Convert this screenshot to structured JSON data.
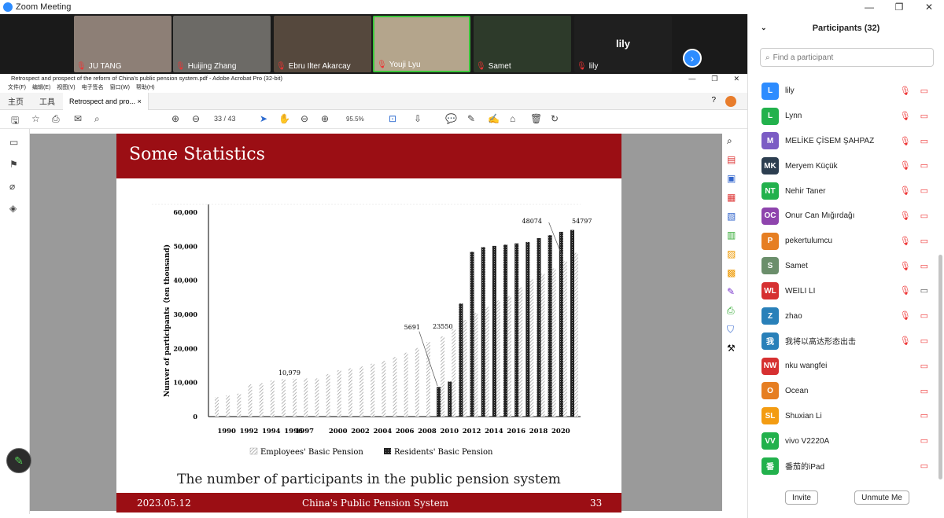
{
  "window": {
    "title": "Zoom Meeting"
  },
  "video_tiles": [
    {
      "name": "JU TANG",
      "bg": "#8d7f76"
    },
    {
      "name": "Huijing Zhang",
      "bg": "#6c6a66"
    },
    {
      "name": "Ebru Ilter Akarcay",
      "bg": "#55483d"
    },
    {
      "name": "Youji Lyu",
      "bg": "#b4a58c"
    },
    {
      "name": "Samet",
      "bg": "#2d3a2a"
    },
    {
      "name": "lily",
      "bg": "#1f1f1f"
    }
  ],
  "tile_center_label": "lily",
  "acrobat": {
    "title": "Retrospect and prospect of the reform of China's public pension system.pdf - Adobe Acrobat Pro (32-bit)",
    "menu": [
      "文件(F)",
      "编辑(E)",
      "视图(V)",
      "电子签名",
      "窗口(W)",
      "帮助(H)"
    ],
    "tabs": {
      "home": "主页",
      "tools": "工具",
      "doc": "Retrospect and pro...",
      "close": "×"
    },
    "page_current": "33",
    "page_total": "/ 43",
    "zoom": "95.5%"
  },
  "slide": {
    "title": "Some Statistics",
    "caption": "The number of participants in the public pension system",
    "footer_date": "2023.05.12",
    "footer_title": "China's Public Pension System",
    "footer_page": "33"
  },
  "chart_data": {
    "type": "bar",
    "ylabel": "Nunver of participants（ten thousand)",
    "ylim": [
      0,
      60000
    ],
    "yticks": [
      "0",
      "10,000",
      "20,000",
      "30,000",
      "40,000",
      "50,000",
      "60,000"
    ],
    "xticks": [
      "1990",
      "1992",
      "1994",
      "1996",
      "1997",
      "2000",
      "2002",
      "2004",
      "2006",
      "2008",
      "2010",
      "2012",
      "2014",
      "2016",
      "2018",
      "2020"
    ],
    "annotations": [
      "10,979",
      "5691",
      "23550",
      "48074",
      "54797"
    ],
    "series": [
      {
        "name": "Employees' Basic Pension",
        "x": [
          1989,
          1990,
          1991,
          1992,
          1993,
          1994,
          1995,
          1996,
          1997,
          1998,
          1999,
          2000,
          2001,
          2002,
          2003,
          2004,
          2005,
          2006,
          2007,
          2008,
          2009,
          2010,
          2011,
          2012,
          2013,
          2014,
          2015,
          2016,
          2017,
          2018,
          2019,
          2020,
          2021
        ],
        "values": [
          5710,
          6166,
          6740,
          9456,
          9848,
          10573,
          10979,
          11117,
          11204,
          11203,
          12486,
          13617,
          14183,
          14737,
          15506,
          16353,
          17488,
          18766,
          20137,
          21891,
          23550,
          25707,
          28391,
          30427,
          32218,
          34124,
          35361,
          37930,
          40293,
          41902,
          43488,
          45621,
          48074
        ]
      },
      {
        "name": "Residents' Basic Pension",
        "x": [
          2009,
          2010,
          2011,
          2012,
          2013,
          2014,
          2015,
          2016,
          2017,
          2018,
          2019,
          2020,
          2021
        ],
        "values": [
          8691,
          10277,
          33182,
          48370,
          49750,
          50107,
          50472,
          50847,
          51255,
          52392,
          53266,
          54244,
          54797
        ]
      }
    ]
  },
  "panel": {
    "title": "Participants (32)",
    "search_placeholder": "Find a participant",
    "participants": [
      {
        "initials": "L",
        "name": "lily",
        "color": "#2d8cff",
        "video": "off"
      },
      {
        "initials": "L",
        "name": "Lynn",
        "color": "#22b14c",
        "video": "off"
      },
      {
        "initials": "M",
        "name": "MELİKE ÇİSEM ŞAHPAZ",
        "color": "#7b5cc4",
        "video": "off"
      },
      {
        "initials": "MK",
        "name": "Meryem Küçük",
        "color": "#2c3e50",
        "video": "off"
      },
      {
        "initials": "NT",
        "name": "Nehir Taner",
        "color": "#22b14c",
        "video": "off"
      },
      {
        "initials": "OC",
        "name": "Onur Can Mığırdağı",
        "color": "#8e44ad",
        "video": "off"
      },
      {
        "initials": "P",
        "name": "pekertulumcu",
        "color": "#e67e22",
        "video": "off"
      },
      {
        "initials": "S",
        "name": "Samet",
        "color": "#6b8e6b",
        "video": "off"
      },
      {
        "initials": "WL",
        "name": "WEILI LI",
        "color": "#d63031",
        "video": "on"
      },
      {
        "initials": "Z",
        "name": "zhao",
        "color": "#2980b9",
        "video": "off"
      },
      {
        "initials": "我",
        "name": "我将以高达形态出击",
        "color": "#2980b9",
        "video": "off"
      },
      {
        "initials": "NW",
        "name": "nku wangfei",
        "color": "#d63031",
        "video": "off"
      },
      {
        "initials": "O",
        "name": "Ocean",
        "color": "#e67e22",
        "video": "off"
      },
      {
        "initials": "SL",
        "name": "Shuxian Li",
        "color": "#f39c12",
        "video": "off"
      },
      {
        "initials": "VV",
        "name": "vivo V2220A",
        "color": "#22b14c",
        "video": "off"
      },
      {
        "initials": "番",
        "name": "番茄的iPad",
        "color": "#22b14c",
        "video": "off"
      }
    ],
    "invite_label": "Invite",
    "unmute_label": "Unmute Me"
  }
}
